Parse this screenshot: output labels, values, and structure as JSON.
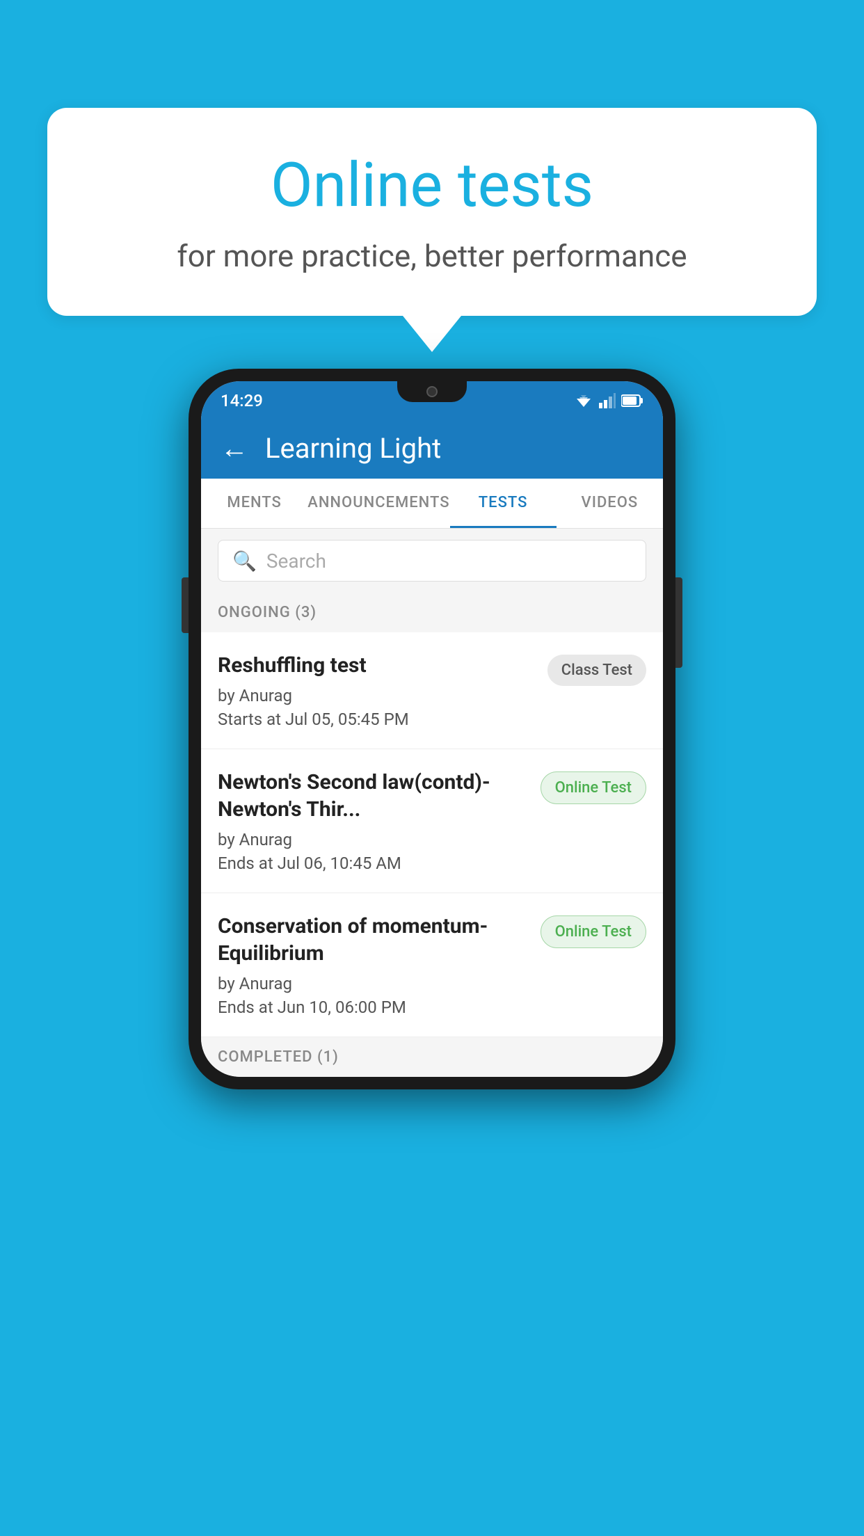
{
  "background": {
    "color": "#1ab0e0"
  },
  "speech_bubble": {
    "title": "Online tests",
    "subtitle": "for more practice, better performance"
  },
  "phone": {
    "status_bar": {
      "time": "14:29"
    },
    "app_bar": {
      "back_label": "←",
      "title": "Learning Light"
    },
    "tabs": [
      {
        "label": "MENTS",
        "active": false
      },
      {
        "label": "ANNOUNCEMENTS",
        "active": false
      },
      {
        "label": "TESTS",
        "active": true
      },
      {
        "label": "VIDEOS",
        "active": false
      }
    ],
    "search": {
      "placeholder": "Search"
    },
    "ongoing_section": {
      "label": "ONGOING (3)"
    },
    "test_items": [
      {
        "name": "Reshuffling test",
        "author": "by Anurag",
        "time_label": "Starts at",
        "time": "Jul 05, 05:45 PM",
        "badge": "Class Test",
        "badge_type": "class"
      },
      {
        "name": "Newton's Second law(contd)-Newton's Thir...",
        "author": "by Anurag",
        "time_label": "Ends at",
        "time": "Jul 06, 10:45 AM",
        "badge": "Online Test",
        "badge_type": "online"
      },
      {
        "name": "Conservation of momentum-Equilibrium",
        "author": "by Anurag",
        "time_label": "Ends at",
        "time": "Jun 10, 06:00 PM",
        "badge": "Online Test",
        "badge_type": "online"
      }
    ],
    "completed_section": {
      "label": "COMPLETED (1)"
    }
  }
}
